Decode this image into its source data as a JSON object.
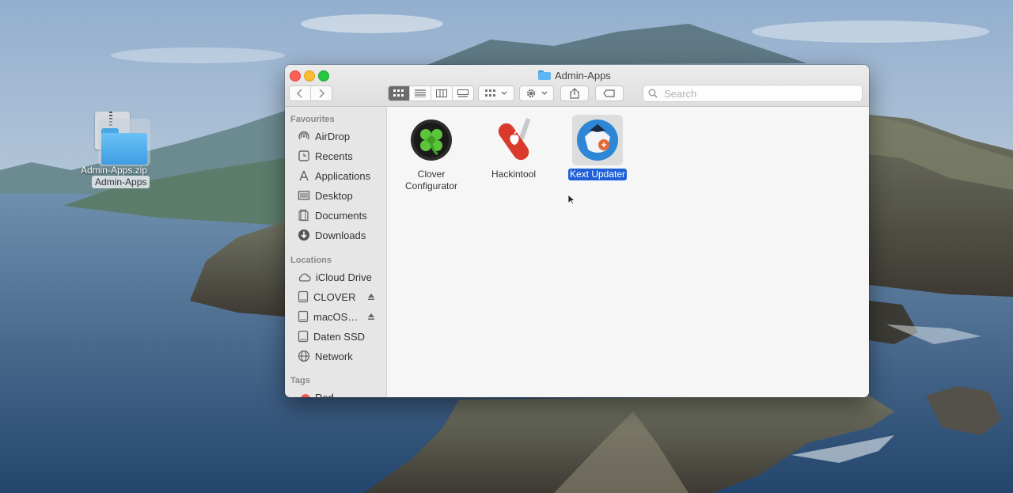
{
  "desktop": {
    "items": [
      {
        "label_zip": "Admin-Apps.zip",
        "label_folder": "Admin-Apps"
      }
    ]
  },
  "window": {
    "title": "Admin-Apps",
    "search_placeholder": "Search",
    "sidebar": {
      "favourites_heading": "Favourites",
      "favourites": [
        {
          "label": "AirDrop",
          "icon": "airdrop-icon"
        },
        {
          "label": "Recents",
          "icon": "clock-icon"
        },
        {
          "label": "Applications",
          "icon": "applications-icon"
        },
        {
          "label": "Desktop",
          "icon": "desktop-icon"
        },
        {
          "label": "Documents",
          "icon": "document-icon"
        },
        {
          "label": "Downloads",
          "icon": "download-icon"
        }
      ],
      "locations_heading": "Locations",
      "locations": [
        {
          "label": "iCloud Drive",
          "icon": "cloud-icon"
        },
        {
          "label": "CLOVER",
          "icon": "drive-icon",
          "eject": true
        },
        {
          "label": "macOS…",
          "icon": "drive-icon",
          "eject": true
        },
        {
          "label": "Daten SSD",
          "icon": "drive-icon"
        },
        {
          "label": "Network",
          "icon": "globe-icon"
        }
      ],
      "tags_heading": "Tags",
      "tags": [
        {
          "label": "Red",
          "color": "#f35b55"
        }
      ]
    },
    "files": [
      {
        "label": "Clover Configurator",
        "icon": "clover-icon",
        "selected": false
      },
      {
        "label": "Hackintool",
        "icon": "swiss-knife-icon",
        "selected": false
      },
      {
        "label": "Kext Updater",
        "icon": "kext-updater-icon",
        "selected": true
      }
    ]
  }
}
